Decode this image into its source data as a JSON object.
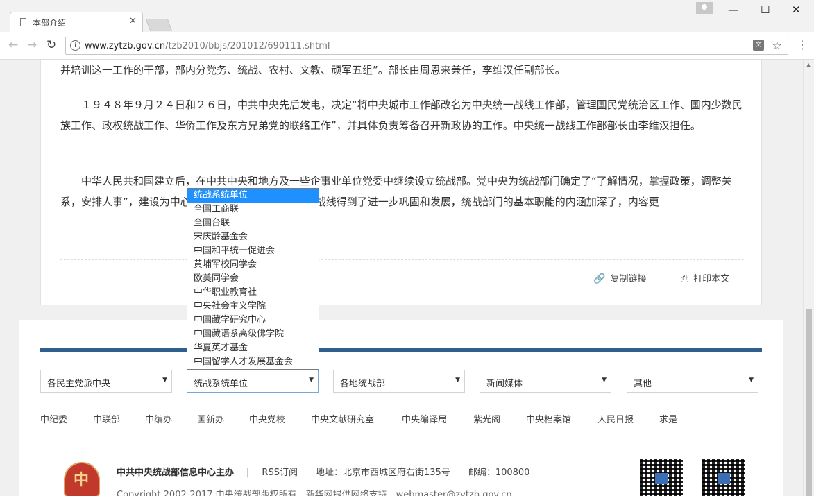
{
  "browser": {
    "tab_title": "本部介绍",
    "url_host": "www.zytzb.gov.cn",
    "url_path": "/tzb2010/bbjs/201012/690111.shtml"
  },
  "article": {
    "p1": "并培训这一工作的干部，部内分党务、统战、农村、文教、顽军五组”。部长由周恩来兼任，李维汉任副部长。",
    "p2": "　　１９４８年９月２４日和２６日，中共中央先后发电，决定“将中央城市工作部改名为中央统一战线工作部，管理国民党统治区工作、国内少数民族工作、政权统战工作、华侨工作及东方兄弟党的联络工作”，并具体负责筹备召开新政协的工作。中央统一战线工作部部长由李维汉担任。",
    "p3": "　　中华人民共和国建立后，在中共中央和地方及一些企事业单位党委中继续设立统战部。党中央为统战部门确定了“了解情况，掌握政策，调整关系，安排人事”，建设为中心的新的历史时期，爱国统一战线得到了进一步巩固和发展，统战部门的基本职能的内涵加深了，内容更",
    "copy_link": "复制链接",
    "print": "打印本文"
  },
  "selects": [
    {
      "value": "各民主党派中央"
    },
    {
      "value": "统战系统单位"
    },
    {
      "value": "各地统战部"
    },
    {
      "value": "新闻媒体"
    },
    {
      "value": "其他"
    }
  ],
  "dropdown_options": [
    "统战系统单位",
    "全国工商联",
    "全国台联",
    "宋庆龄基金会",
    "中国和平统一促进会",
    "黄埔军校同学会",
    "欧美同学会",
    "中华职业教育社",
    "中央社会主义学院",
    "中国藏学研究中心",
    "中国藏语系高级佛学院",
    "华夏英才基金",
    "中国留学人才发展基金会"
  ],
  "footer_links": [
    "中纪委",
    "中联部",
    "中编办",
    "国新办",
    "中央党校",
    "中央文献研究室",
    "中央编译局",
    "紫光阁",
    "中央档案馆",
    "人民日报",
    "求是"
  ],
  "footer": {
    "sponsor": "中共中央统战部信息中心主办",
    "divider": "|",
    "rss": "RSS订阅",
    "address": "地址：北京市西城区府右街135号",
    "postcode": "邮编：100800",
    "copyright": "Copyright 2002-2017 中央统战部版权所有　新华网提供网络支持　webmaster@zytzb.gov.cn"
  },
  "colors": {
    "accent_line": "#2f5f8d",
    "selected_option": "#1e90ff"
  }
}
